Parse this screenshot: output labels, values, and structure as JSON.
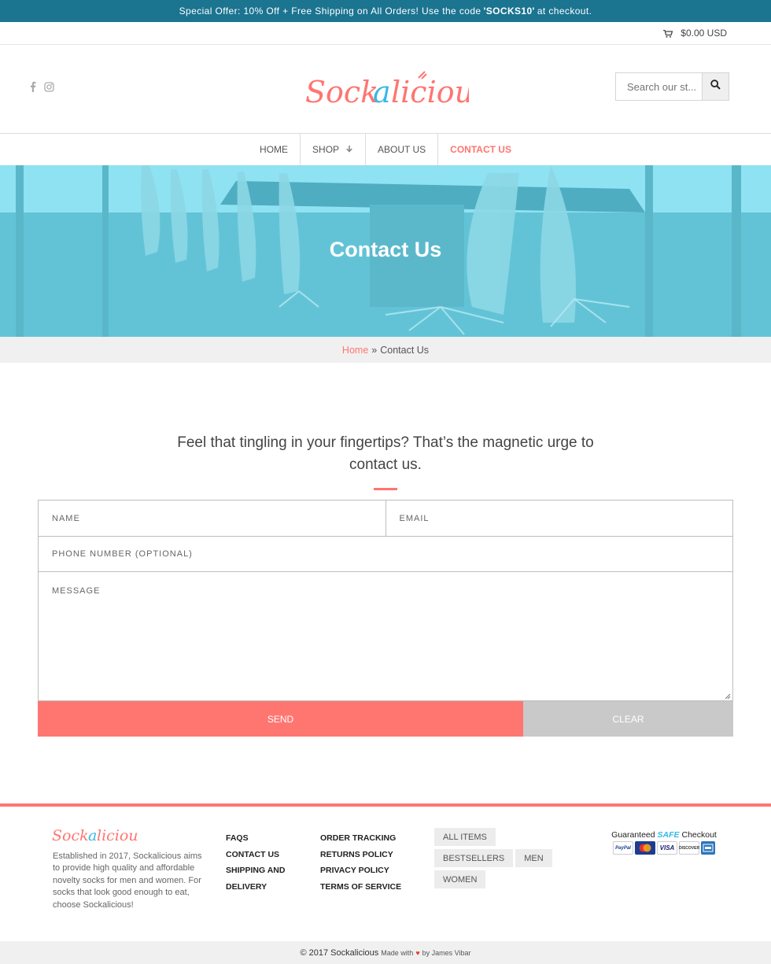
{
  "announcement": {
    "before": "Special Offer: 10% Off + Free Shipping on All Orders! Use the code",
    "code": "'SOCKS10'",
    "after": "at checkout."
  },
  "cart": {
    "total": "$0.00 USD",
    "icon": "shopping-cart-icon"
  },
  "header": {
    "logo_text": "Sockalicious",
    "social": [
      "facebook-icon",
      "instagram-icon"
    ],
    "search_placeholder": "Search our st...",
    "search_icon": "search-icon"
  },
  "nav": {
    "items": [
      {
        "label": "Home"
      },
      {
        "label": "Shop"
      },
      {
        "label": "About Us"
      },
      {
        "label": "Contact Us"
      }
    ]
  },
  "hero": {
    "title": "Contact Us"
  },
  "breadcrumb": {
    "home": "Home",
    "sep": "»",
    "current": "Contact Us"
  },
  "contact": {
    "intro": "Feel that tingling in your fingertips? That’s the magnetic urge to contact us.",
    "fields": {
      "name": "NAME",
      "email": "EMAIL",
      "phone": "PHONE NUMBER (OPTIONAL)",
      "message": "MESSAGE"
    },
    "send_label": "Send",
    "clear_label": "Clear"
  },
  "footer": {
    "logo_text": "Sockalicious",
    "about": "Established in 2017, Sockalicious aims to provide high quality and affordable novelty socks for men and women. For socks that look good enough to eat, choose Sockalicious!",
    "links_col1": [
      "FAQs",
      "Contact Us",
      "Shipping and Delivery"
    ],
    "links_col2": [
      "Order Tracking",
      "Returns Policy",
      "Privacy Policy",
      "Terms of Service"
    ],
    "tags": [
      "All Items",
      "Bestsellers",
      "Men",
      "Women"
    ],
    "safe_checkout": {
      "prefix": "Guaranteed",
      "safe": "SAFE",
      "suffix": "Checkout"
    },
    "cards": [
      "PayPal",
      "MasterCard",
      "VISA",
      "DISCOVER",
      "AMEX"
    ]
  },
  "copyright": {
    "main": "© 2017 Sockalicious",
    "made_with": "Made with",
    "by": "by James Vibar"
  },
  "colors": {
    "accent": "#ff7570",
    "announcement_bg": "#1b7490",
    "hero_tint": "#6ccadd",
    "clear_button": "#c9c9c9"
  }
}
